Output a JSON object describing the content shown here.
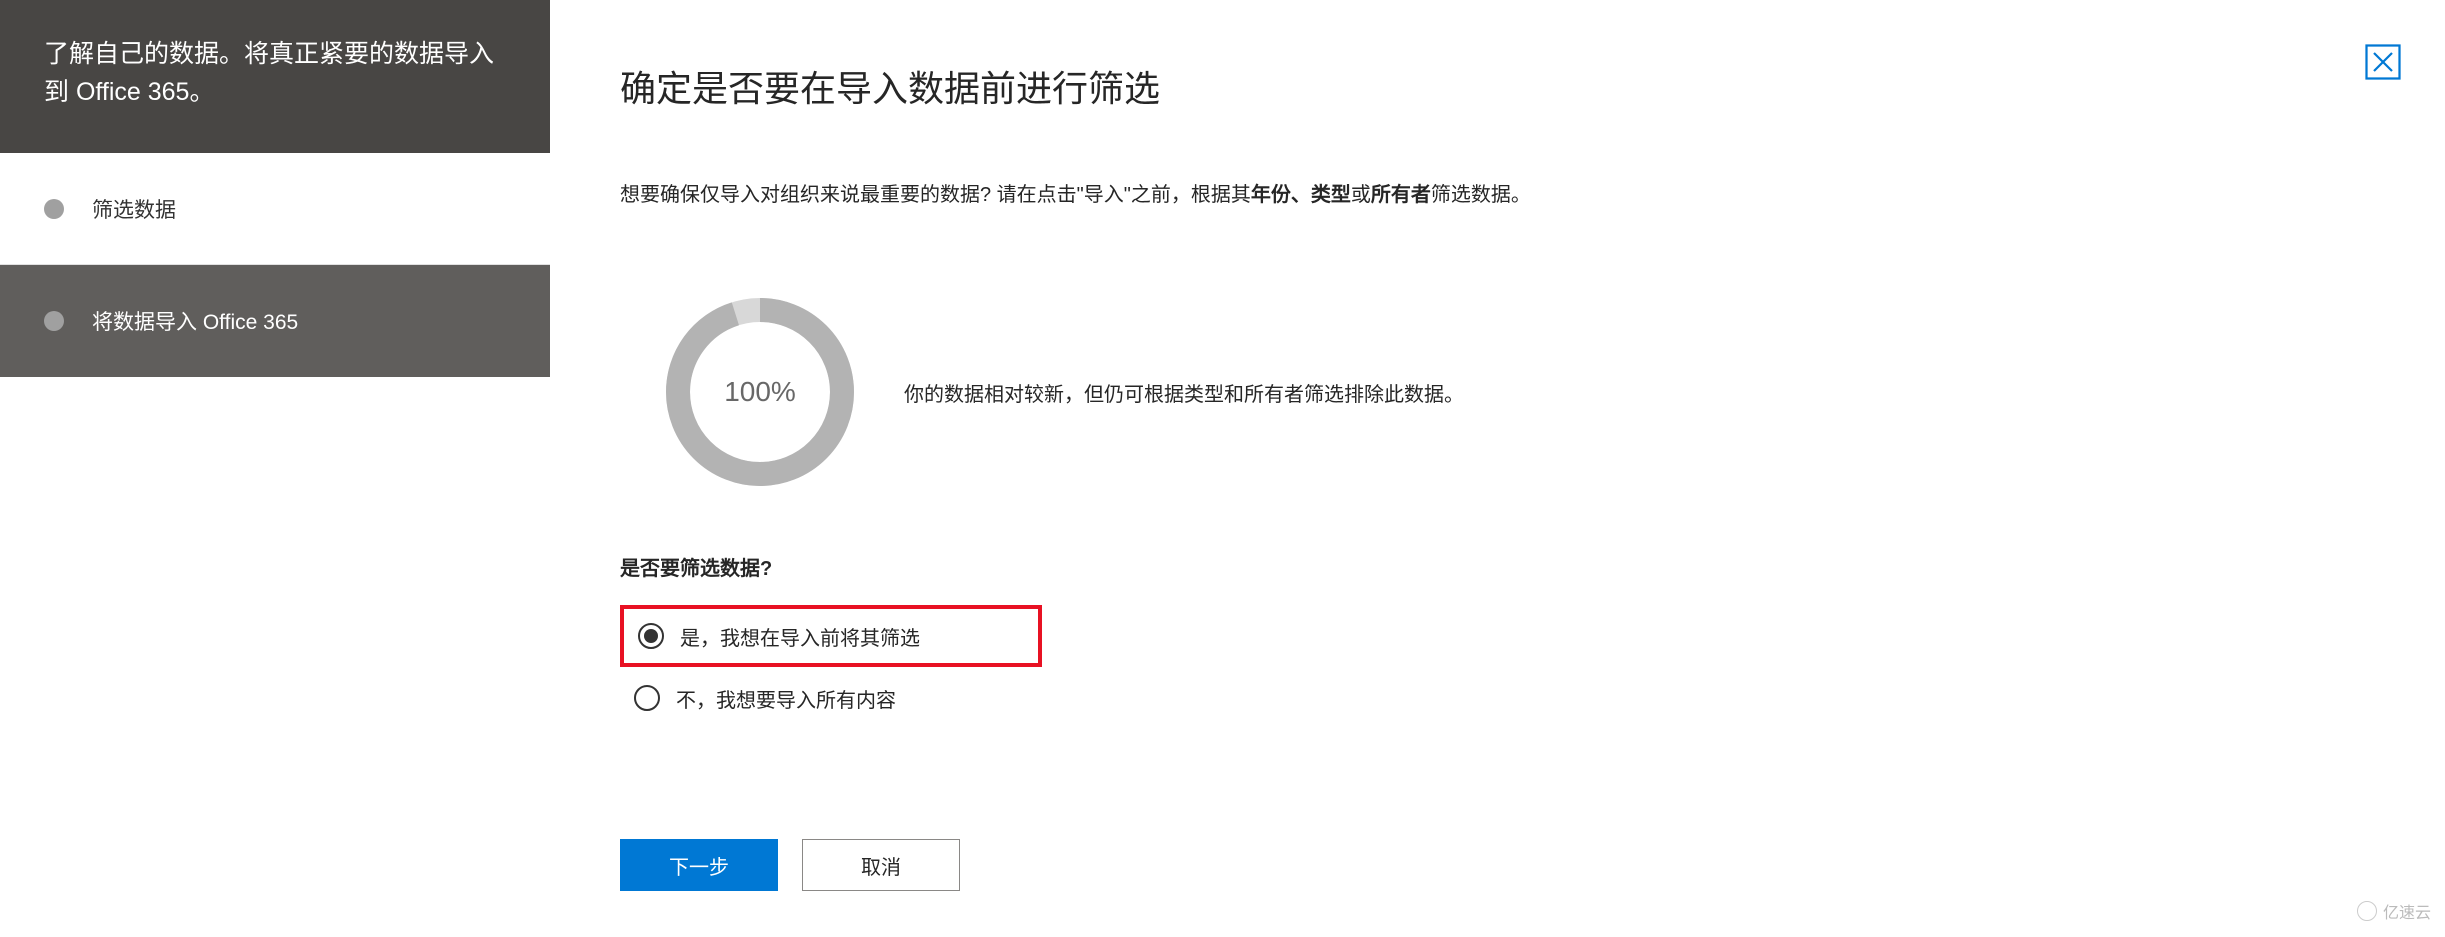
{
  "sidebar": {
    "header": "了解自己的数据。将真正紧要的数据导入到 Office 365。",
    "steps": [
      {
        "label": "筛选数据"
      },
      {
        "label": "将数据导入 Office 365"
      }
    ]
  },
  "main": {
    "title": "确定是否要在导入数据前进行筛选",
    "description_pre": "想要确保仅导入对组织来说最重要的数据? 请在点击\"导入\"之前，根据其",
    "description_bold1": "年份、类型",
    "description_mid": "或",
    "description_bold2": "所有者",
    "description_post": "筛选数据。",
    "progress_percent": "100%",
    "progress_note": "你的数据相对较新，但仍可根据类型和所有者筛选排除此数据。",
    "question": "是否要筛选数据?",
    "options": {
      "yes": "是，我想在导入前将其筛选",
      "no": "不，我想要导入所有内容"
    },
    "buttons": {
      "next": "下一步",
      "cancel": "取消"
    }
  },
  "watermark": "亿速云"
}
